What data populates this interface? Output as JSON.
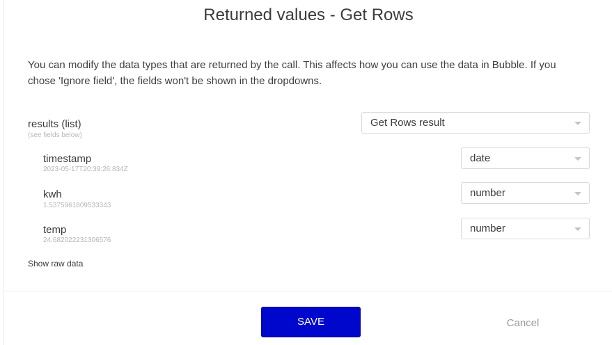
{
  "modal": {
    "title": "Returned values - Get Rows",
    "description": "You can modify the data types that are returned by the call. This affects how you can use the data in Bubble. If you chose 'Ignore field', the fields won't be shown in the dropdowns."
  },
  "results": {
    "label": "results (list)",
    "sub": "(see fields below)",
    "type": "Get Rows result"
  },
  "fields": [
    {
      "name": "timestamp",
      "sample": "2023-05-17T20:39:26.834Z",
      "type": "date"
    },
    {
      "name": "kwh",
      "sample": "1.5375961809533343",
      "type": "number"
    },
    {
      "name": "temp",
      "sample": "24.682022231306576",
      "type": "number"
    }
  ],
  "links": {
    "show_raw": "Show raw data"
  },
  "buttons": {
    "save": "SAVE",
    "cancel": "Cancel"
  },
  "colors": {
    "accent": "#0007cc"
  }
}
